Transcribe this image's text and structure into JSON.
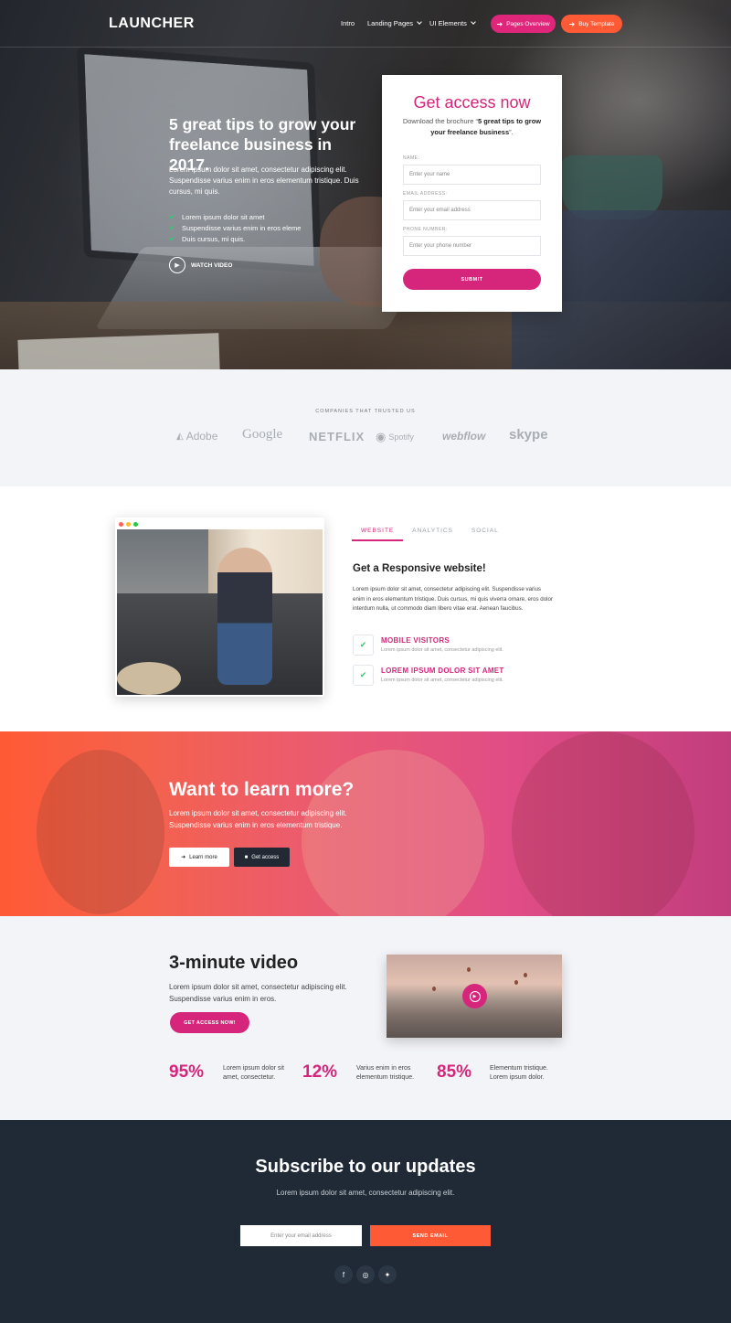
{
  "nav": {
    "logo": "LAUNCHER",
    "links": [
      "Intro",
      "Landing Pages",
      "UI Elements"
    ],
    "btn_pages": "Pages Overview",
    "btn_buy": "Buy Template",
    "colors": {
      "pages": "#e0267b",
      "buy": "#ff5a36"
    }
  },
  "hero": {
    "title": "5 great tips to grow your freelance business in 2017.",
    "desc": "Lorem ipsum dolor sit amet, consectetur adipiscing elit. Suspendisse varius enim in eros elementum tristique. Duis cursus, mi quis.",
    "list": [
      "Lorem ipsum dolor sit amet",
      "Suspendisse varius enim in eros eleme",
      "Duis cursus, mi quis."
    ],
    "watch": "WATCH VIDEO"
  },
  "form": {
    "title": "Get access now",
    "sub_prefix": "Download the brochure “",
    "sub_bold": "5 great tips to grow your freelance business",
    "sub_suffix": "”.",
    "name_label": "NAME:",
    "name_placeholder": "Enter your name",
    "email_label": "EMAIL ADDRESS:",
    "email_placeholder": "Enter your email address",
    "phone_label": "PHONE NUMBER:",
    "phone_placeholder": "Enter your phone number",
    "submit": "SUBMIT"
  },
  "companies": {
    "title": "COMPANIES THAT TRUSTED US",
    "brands": [
      "Adobe",
      "Google",
      "NETFLIX",
      "Spotify",
      "webflow",
      "skype"
    ]
  },
  "responsive": {
    "tabs": [
      "WEBSITE",
      "ANALYTICS",
      "SOCIAL"
    ],
    "title": "Get a Responsive website!",
    "desc": "Lorem ipsum dolor sit amet, consectetur adipiscing elit. Suspendisse varius enim in eros elementum tristique. Duis cursus, mi quis viverra ornare, eros dolor interdum nulla, ut commodo diam libero vitae erat. Aenean faucibus.",
    "features": [
      {
        "title": "MOBILE VISITORS",
        "desc": "Lorem ipsum dolor sit amet, consectetur adipiscing elit."
      },
      {
        "title": "LOREM IPSUM DOLOR SIT AMET",
        "desc": "Lorem ipsum dolor sit amet, consectetur adipiscing elit."
      }
    ]
  },
  "learn": {
    "title": "Want to learn more?",
    "desc": "Lorem ipsum dolor sit amet, consectetur adipiscing elit. Suspendisse varius enim in eros elementum tristique.",
    "btn_learn": "Learn more",
    "btn_access": "Get access"
  },
  "video": {
    "title": "3-minute video",
    "desc": "Lorem ipsum dolor sit amet, consectetur adipiscing elit. Suspendisse varius enim in eros.",
    "btn": "GET ACCESS NOW!",
    "stats": [
      {
        "value": "95%",
        "label": "Lorem ipsum dolor sit amet, consectetur."
      },
      {
        "value": "12%",
        "label": "Varius enim in eros elementum tristique."
      },
      {
        "value": "85%",
        "label": "Elementum tristique. Lorem ipsum dolor."
      }
    ]
  },
  "subscribe": {
    "title": "Subscribe to our updates",
    "desc": "Lorem ipsum dolor sit amet, consectetur adipiscing elit.",
    "placeholder": "Enter your email address",
    "btn": "SEND EMAIL",
    "social": [
      "facebook-icon",
      "instagram-icon",
      "twitter-icon"
    ]
  }
}
